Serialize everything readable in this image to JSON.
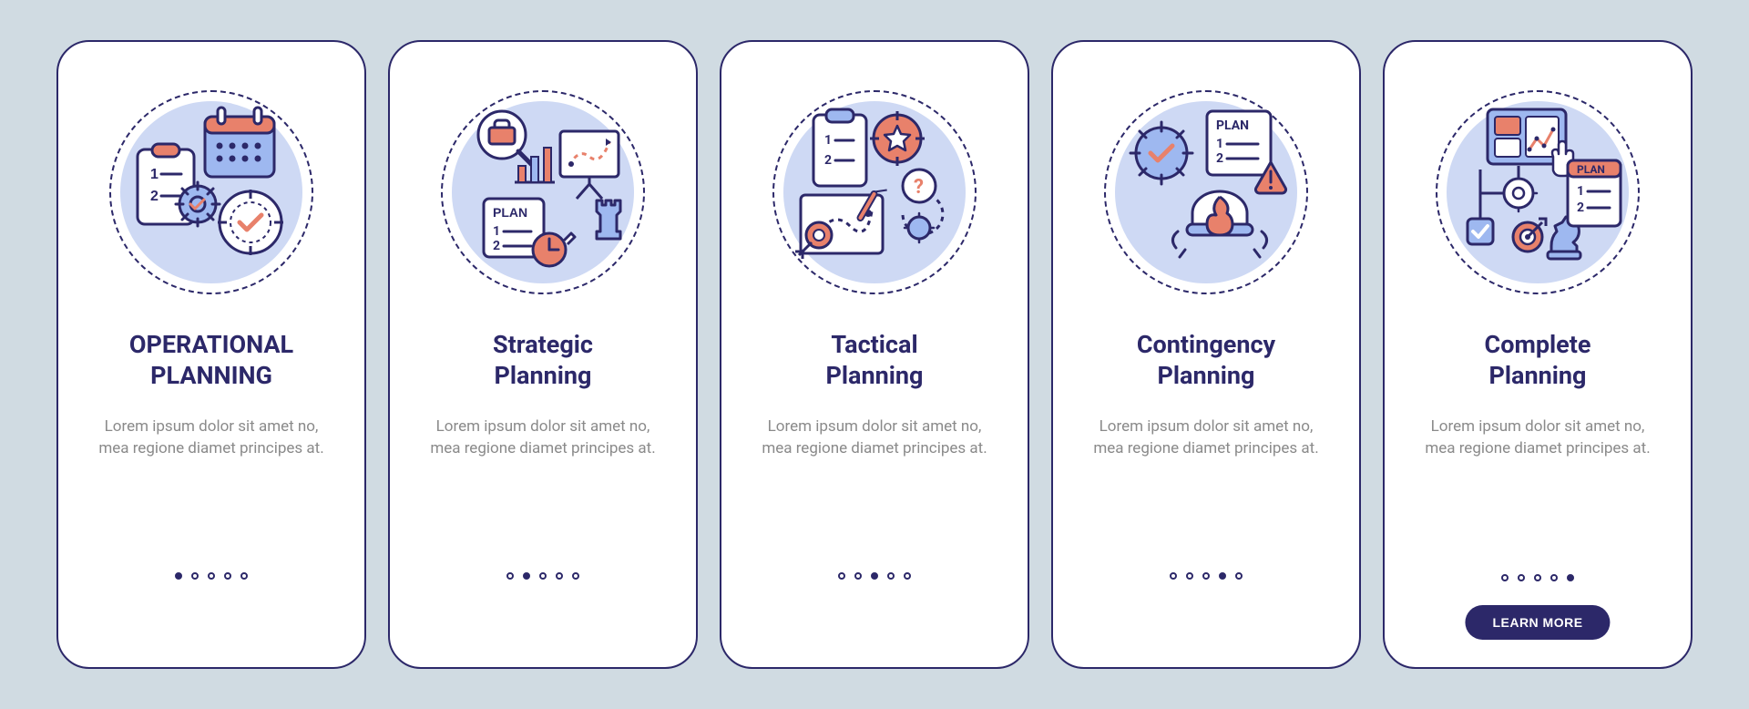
{
  "colors": {
    "primary": "#2c2869",
    "accent": "#e8816b",
    "light_blue": "#ced9f4",
    "bg": "#d0dbe2",
    "grey_text": "#8a8a8a"
  },
  "cta_label": "LEARN MORE",
  "lorem": "Lorem ipsum dolor sit amet no, mea regione diamet principes at.",
  "slides": [
    {
      "title": "OPERATIONAL\nPLANNING",
      "icon_name": "operational-planning-icon",
      "active_index": 0
    },
    {
      "title": "Strategic\nPlanning",
      "icon_name": "strategic-planning-icon",
      "active_index": 1
    },
    {
      "title": "Tactical\nPlanning",
      "icon_name": "tactical-planning-icon",
      "active_index": 2
    },
    {
      "title": "Contingency\nPlanning",
      "icon_name": "contingency-planning-icon",
      "active_index": 3
    },
    {
      "title": "Complete\nPlanning",
      "icon_name": "complete-planning-icon",
      "active_index": 4
    }
  ]
}
